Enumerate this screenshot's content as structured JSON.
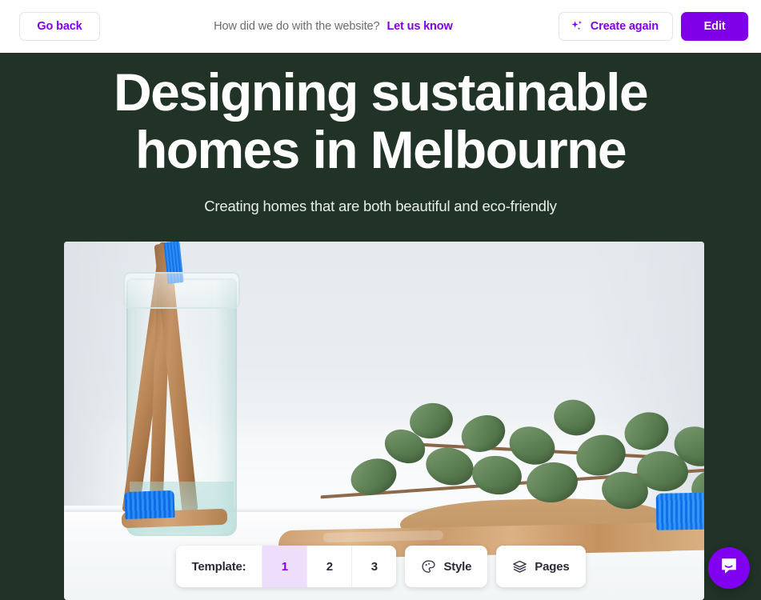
{
  "topbar": {
    "go_back_label": "Go back",
    "feedback_question": "How did we do with the website?",
    "feedback_link_label": "Let us know",
    "create_again_label": "Create again",
    "edit_label": "Edit",
    "create_again_icon": "sparkle-icon",
    "accent_color": "#7F00E8"
  },
  "page": {
    "background_color": "#203326",
    "title": "Designing sustainable homes in Melbourne",
    "subtitle": "Creating homes that are both beautiful and eco-friendly",
    "hero_image_alt": "Bamboo toothbrushes with blue bristles in a glass jar beside eucalyptus branches on a white counter"
  },
  "toolbar": {
    "template_label": "Template:",
    "template_options": [
      "1",
      "2",
      "3"
    ],
    "template_selected": "1",
    "selected_bg_color": "#EEDEFB",
    "selected_text_color": "#7F00E8",
    "style_label": "Style",
    "style_icon": "palette-icon",
    "pages_label": "Pages",
    "pages_icon": "layers-icon"
  },
  "chat": {
    "launcher_icon": "chat-bubble-icon",
    "launcher_color": "#8000F0"
  }
}
